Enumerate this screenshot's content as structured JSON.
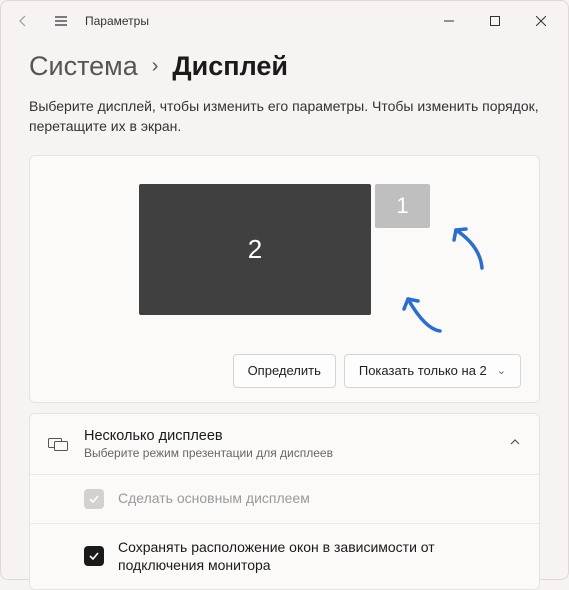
{
  "titlebar": {
    "title": "Параметры"
  },
  "breadcrumb": {
    "parent": "Система",
    "current": "Дисплей"
  },
  "subtitle": "Выберите дисплей, чтобы изменить его параметры. Чтобы изменить порядок, перетащите их в экран.",
  "arrange": {
    "monitors": [
      {
        "id": "2",
        "primary": true
      },
      {
        "id": "1",
        "primary": false
      }
    ],
    "identify_label": "Определить",
    "mode_label": "Показать только на 2"
  },
  "multi": {
    "title": "Несколько дисплеев",
    "subtitle": "Выберите режим презентации для дисплеев",
    "options": [
      {
        "label": "Сделать основным дисплеем",
        "checked": true,
        "enabled": false
      },
      {
        "label": "Сохранять расположение окон в зависимости от подключения монитора",
        "checked": true,
        "enabled": true
      }
    ]
  }
}
